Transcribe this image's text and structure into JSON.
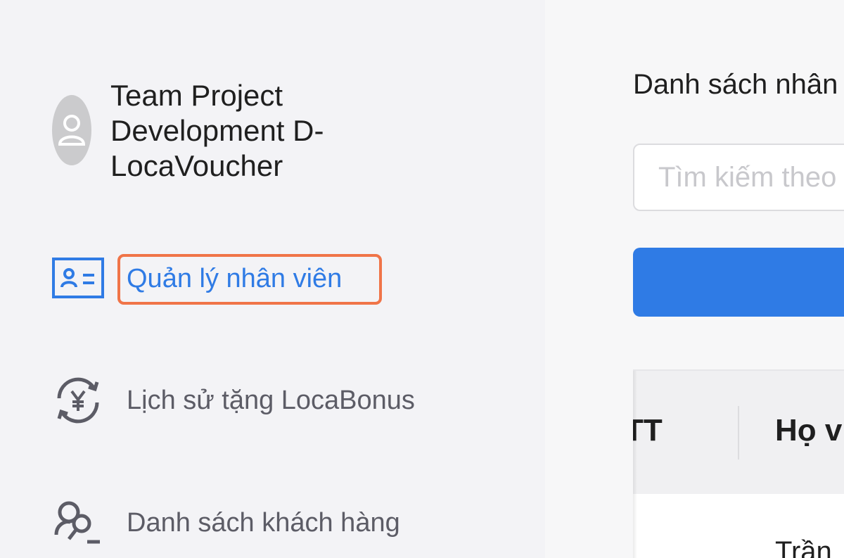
{
  "sidebar": {
    "team_name": "Team Project Development D-LocaVoucher",
    "items": [
      {
        "label": "Quản lý nhân viên",
        "icon": "id-card-icon",
        "active": true
      },
      {
        "label": "Lịch sử tặng LocaBonus",
        "icon": "yen-exchange-icon",
        "active": false
      },
      {
        "label": "Danh sách khách hàng",
        "icon": "customer-search-icon",
        "active": false
      }
    ]
  },
  "main": {
    "title": "Danh sách nhân",
    "search": {
      "placeholder": "Tìm kiếm theo"
    },
    "table": {
      "headers": [
        "TT",
        "Họ v"
      ],
      "rows": [
        {
          "name": "Trần"
        }
      ]
    }
  },
  "colors": {
    "accent": "#2f7be5",
    "highlight": "#f07448",
    "sidebar_bg": "#f3f3f6"
  }
}
